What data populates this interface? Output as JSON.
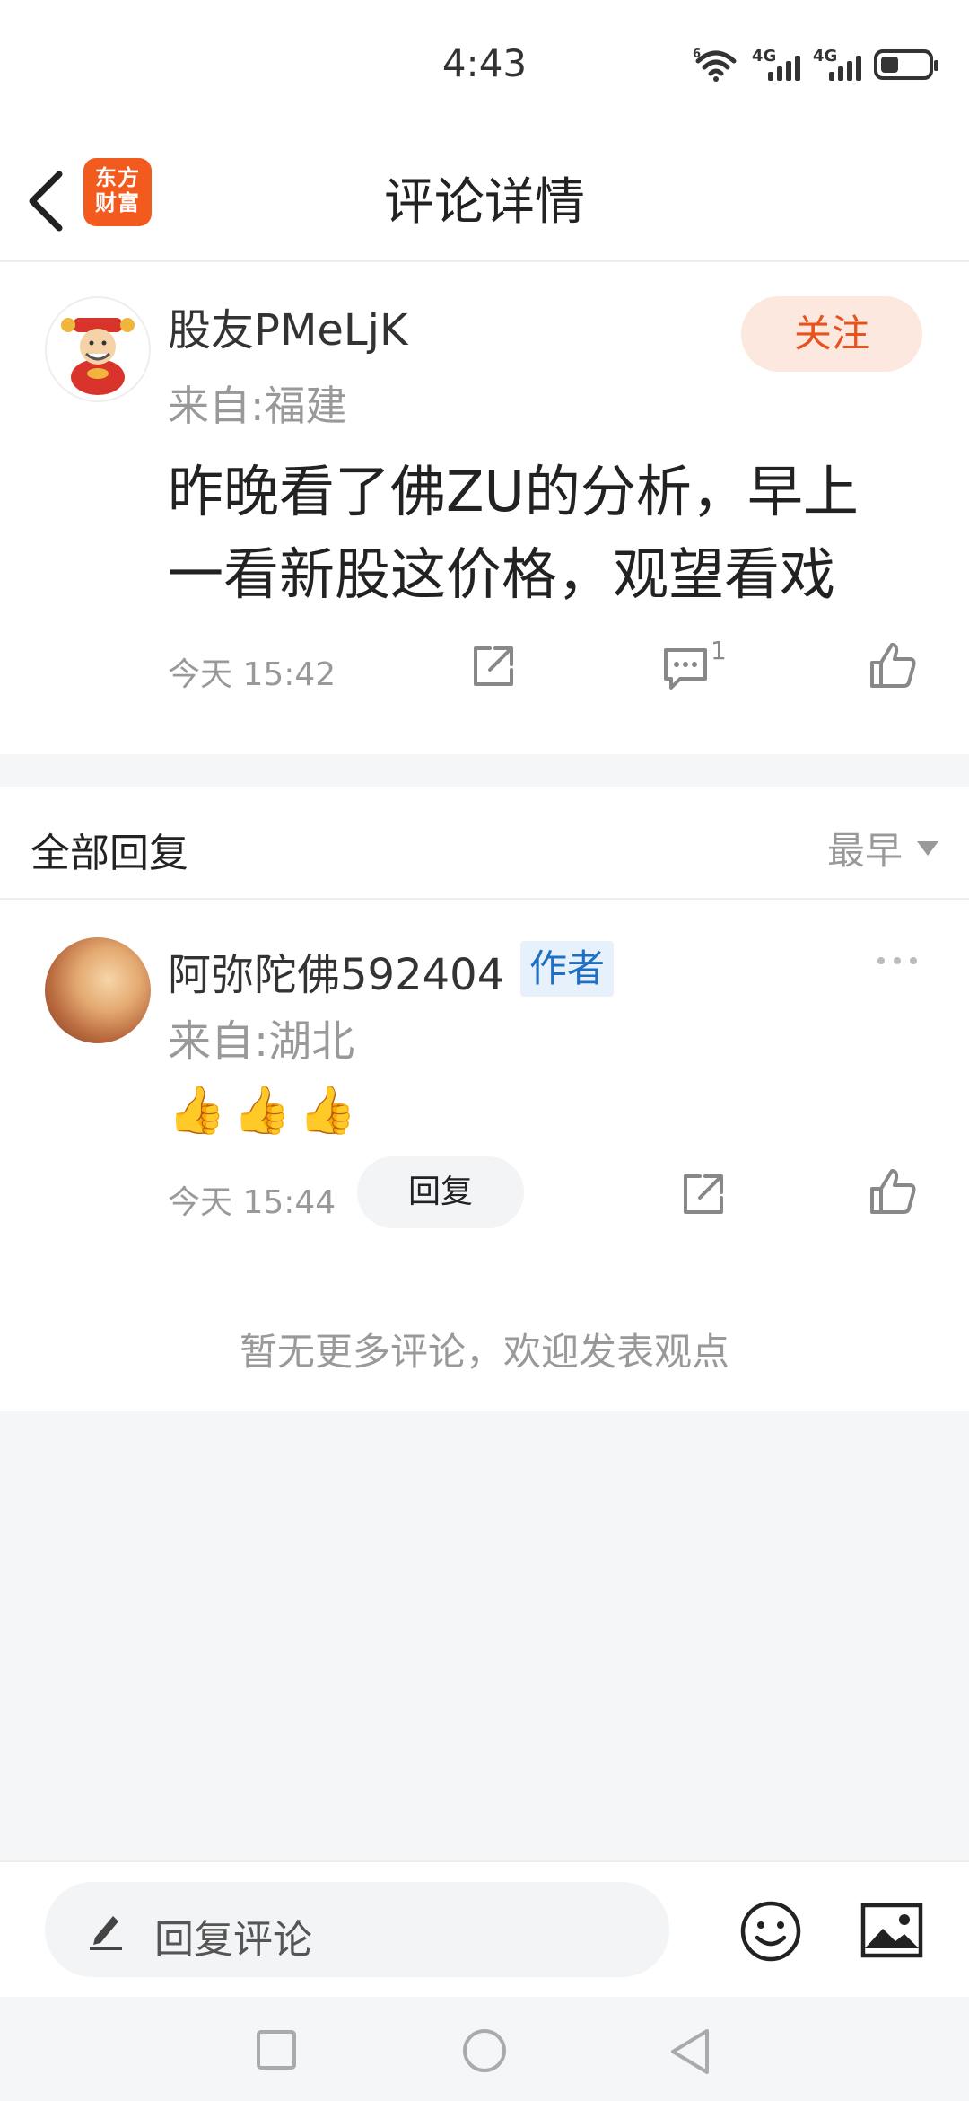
{
  "status_bar": {
    "time": "4:43",
    "signal1": "4G",
    "signal2": "4G",
    "wifi_badge": "6",
    "battery_level": 0.38
  },
  "header": {
    "title": "评论详情",
    "logo_line1": "东方",
    "logo_line2": "财富"
  },
  "comment": {
    "username": "股友PMeLjK",
    "location": "来自:福建",
    "follow_label": "关注",
    "text": "昨晚看了佛ZU的分析，早上一看新股这价格，观望看戏",
    "time": "今天 15:42",
    "comment_count": "1"
  },
  "replies": {
    "title": "全部回复",
    "sort_label": "最早",
    "items": [
      {
        "username": "阿弥陀佛592404",
        "badge": "作者",
        "location": "来自:湖北",
        "emojis": "👍👍👍",
        "time": "今天 15:44",
        "reply_label": "回复"
      }
    ],
    "empty_hint": "暂无更多评论，欢迎发表观点"
  },
  "bottom_bar": {
    "input_placeholder": "回复评论"
  },
  "colors": {
    "accent": "#f25a1e",
    "follow_bg": "#fde8df",
    "badge_blue": "#1f6fc4"
  }
}
